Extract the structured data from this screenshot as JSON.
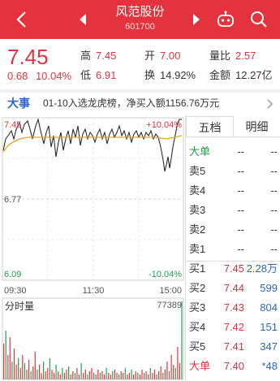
{
  "header": {
    "title": "风范股份",
    "code": "601700"
  },
  "quote": {
    "price": "7.45",
    "change": "0.68",
    "change_pct": "10.04%",
    "high_label": "高",
    "high": "7.45",
    "open_label": "开",
    "open": "7.00",
    "volume_ratio_label": "量比",
    "volume_ratio": "2.57",
    "low_label": "低",
    "low": "6.91",
    "turnover_label": "换",
    "turnover": "14.92%",
    "amount_label": "金额",
    "amount": "12.27亿"
  },
  "news": {
    "tag": "大事",
    "text": "01-10入选龙虎榜，净买入额1156.76万元"
  },
  "chart": {
    "price_top": "7.45",
    "pct_top": "+10.04%",
    "price_mid": "6.77",
    "price_bottom": "6.09",
    "pct_bottom": "-10.04%",
    "time_start": "09:30",
    "time_mid": "11:30",
    "time_end": "15:00",
    "volume_label": "分时量",
    "volume_max": "77389",
    "colors": {
      "price_line": "#1a1a1a",
      "avg_line": "#e3a21a",
      "up": "#e5333d",
      "down": "#22a14a"
    }
  },
  "book": {
    "tabs": [
      "五档",
      "明细"
    ],
    "rows": [
      {
        "label": "大单",
        "price": "--",
        "qty": "--"
      },
      {
        "label": "卖5",
        "price": "--",
        "qty": "--"
      },
      {
        "label": "卖4",
        "price": "--",
        "qty": "--"
      },
      {
        "label": "卖3",
        "price": "--",
        "qty": "--"
      },
      {
        "label": "卖2",
        "price": "--",
        "qty": "--"
      },
      {
        "label": "卖1",
        "price": "--",
        "qty": "--"
      },
      {
        "label": "买1",
        "price": "7.45",
        "qty": "2.28万"
      },
      {
        "label": "买2",
        "price": "7.44",
        "qty": "599"
      },
      {
        "label": "买3",
        "price": "7.43",
        "qty": "804"
      },
      {
        "label": "买4",
        "price": "7.42",
        "qty": "151"
      },
      {
        "label": "买5",
        "price": "7.41",
        "qty": "347"
      },
      {
        "label": "大单",
        "price": "7.40",
        "qty": "*48"
      }
    ]
  },
  "icons": [
    "back-icon",
    "prev-stock-icon",
    "next-stock-icon",
    "robot-icon",
    "search-icon",
    "chevron-right-icon"
  ]
}
